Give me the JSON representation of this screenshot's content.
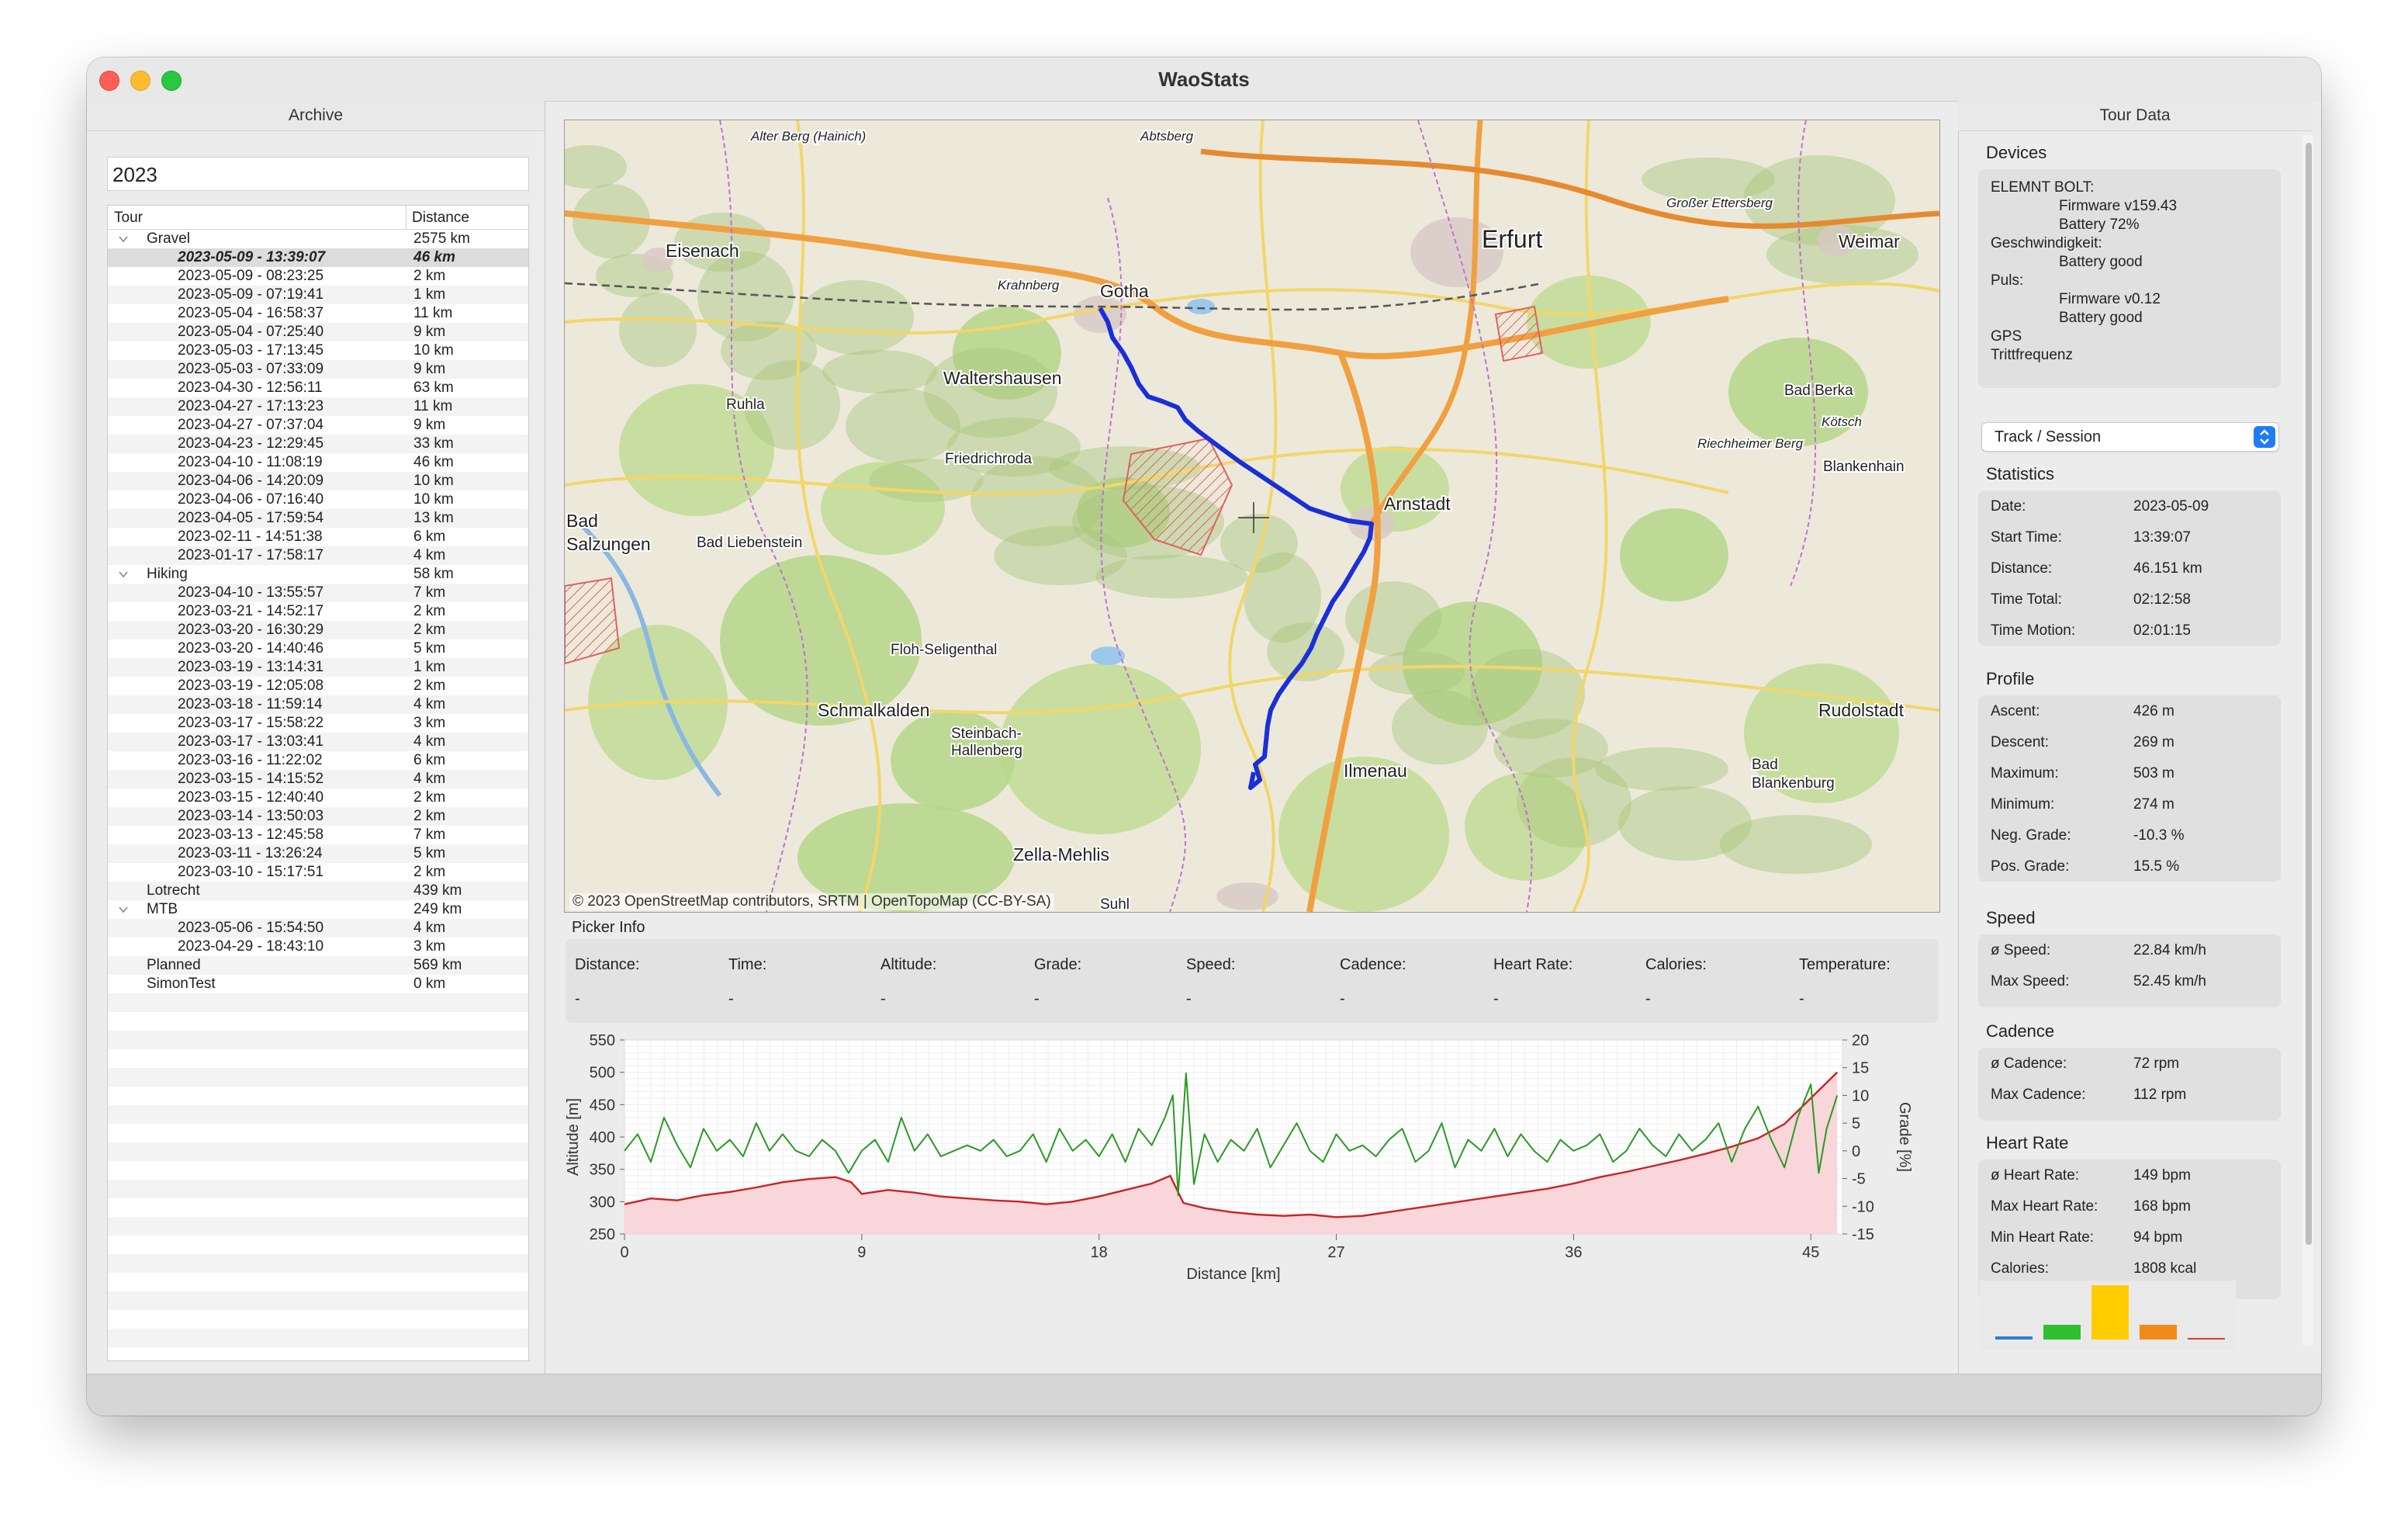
{
  "window": {
    "title": "WaoStats"
  },
  "archive": {
    "header": "Archive",
    "search_value": "2023",
    "col_tour": "Tour",
    "col_distance": "Distance",
    "rows": [
      {
        "label": "Gravel",
        "dist": "2575 km",
        "level": 0,
        "disclosure": "open"
      },
      {
        "label": "2023-05-09 - 13:39:07",
        "dist": "46 km",
        "level": 1,
        "selected": true
      },
      {
        "label": "2023-05-09 - 08:23:25",
        "dist": "2 km",
        "level": 1
      },
      {
        "label": "2023-05-09 - 07:19:41",
        "dist": "1 km",
        "level": 1
      },
      {
        "label": "2023-05-04 - 16:58:37",
        "dist": "11 km",
        "level": 1
      },
      {
        "label": "2023-05-04 - 07:25:40",
        "dist": "9 km",
        "level": 1
      },
      {
        "label": "2023-05-03 - 17:13:45",
        "dist": "10 km",
        "level": 1
      },
      {
        "label": "2023-05-03 - 07:33:09",
        "dist": "9 km",
        "level": 1
      },
      {
        "label": "2023-04-30 - 12:56:11",
        "dist": "63 km",
        "level": 1
      },
      {
        "label": "2023-04-27 - 17:13:23",
        "dist": "11 km",
        "level": 1
      },
      {
        "label": "2023-04-27 - 07:37:04",
        "dist": "9 km",
        "level": 1
      },
      {
        "label": "2023-04-23 - 12:29:45",
        "dist": "33 km",
        "level": 1
      },
      {
        "label": "2023-04-10 - 11:08:19",
        "dist": "46 km",
        "level": 1
      },
      {
        "label": "2023-04-06 - 14:20:09",
        "dist": "10 km",
        "level": 1
      },
      {
        "label": "2023-04-06 - 07:16:40",
        "dist": "10 km",
        "level": 1
      },
      {
        "label": "2023-04-05 - 17:59:54",
        "dist": "13 km",
        "level": 1
      },
      {
        "label": "2023-02-11 - 14:51:38",
        "dist": "6 km",
        "level": 1
      },
      {
        "label": "2023-01-17 - 17:58:17",
        "dist": "4 km",
        "level": 1
      },
      {
        "label": "Hiking",
        "dist": "58 km",
        "level": 0,
        "disclosure": "open"
      },
      {
        "label": "2023-04-10 - 13:55:57",
        "dist": "7 km",
        "level": 1
      },
      {
        "label": "2023-03-21 - 14:52:17",
        "dist": "2 km",
        "level": 1
      },
      {
        "label": "2023-03-20 - 16:30:29",
        "dist": "2 km",
        "level": 1
      },
      {
        "label": "2023-03-20 - 14:40:46",
        "dist": "5 km",
        "level": 1
      },
      {
        "label": "2023-03-19 - 13:14:31",
        "dist": "1 km",
        "level": 1
      },
      {
        "label": "2023-03-19 - 12:05:08",
        "dist": "2 km",
        "level": 1
      },
      {
        "label": "2023-03-18 - 11:59:14",
        "dist": "4 km",
        "level": 1
      },
      {
        "label": "2023-03-17 - 15:58:22",
        "dist": "3 km",
        "level": 1
      },
      {
        "label": "2023-03-17 - 13:03:41",
        "dist": "4 km",
        "level": 1
      },
      {
        "label": "2023-03-16 - 11:22:02",
        "dist": "6 km",
        "level": 1
      },
      {
        "label": "2023-03-15 - 14:15:52",
        "dist": "4 km",
        "level": 1
      },
      {
        "label": "2023-03-15 - 12:40:40",
        "dist": "2 km",
        "level": 1
      },
      {
        "label": "2023-03-14 - 13:50:03",
        "dist": "2 km",
        "level": 1
      },
      {
        "label": "2023-03-13 - 12:45:58",
        "dist": "7 km",
        "level": 1
      },
      {
        "label": "2023-03-11 - 13:26:24",
        "dist": "5 km",
        "level": 1
      },
      {
        "label": "2023-03-10 - 15:17:51",
        "dist": "2 km",
        "level": 1
      },
      {
        "label": "Lotrecht",
        "dist": "439 km",
        "level": 0
      },
      {
        "label": "MTB",
        "dist": "249 km",
        "level": 0,
        "disclosure": "open"
      },
      {
        "label": "2023-05-06 - 15:54:50",
        "dist": "4 km",
        "level": 1
      },
      {
        "label": "2023-04-29 - 18:43:10",
        "dist": "3 km",
        "level": 1
      },
      {
        "label": "Planned",
        "dist": "569 km",
        "level": 0
      },
      {
        "label": "SimonTest",
        "dist": "0 km",
        "level": 0
      }
    ]
  },
  "map": {
    "copyright": "© 2023 OpenStreetMap contributors, SRTM | OpenTopoMap (CC-BY-SA)",
    "places": [
      {
        "name": "Alter Berg (Hainich)",
        "size": "s"
      },
      {
        "name": "Abtsberg",
        "size": "s"
      },
      {
        "name": "Erfurt",
        "size": "xl"
      },
      {
        "name": "Großer Ettersberg",
        "size": "s"
      },
      {
        "name": "Weimar",
        "size": "l"
      },
      {
        "name": "Eisenach",
        "size": "l"
      },
      {
        "name": "Krahnberg",
        "size": "s"
      },
      {
        "name": "Gotha",
        "size": "l"
      },
      {
        "name": "Waltershausen",
        "size": "l"
      },
      {
        "name": "Bad Berka",
        "size": "m"
      },
      {
        "name": "Kötsch",
        "size": "s"
      },
      {
        "name": "Ruhla",
        "size": "m"
      },
      {
        "name": "Friedrichroda",
        "size": "m"
      },
      {
        "name": "Riechheimer Berg",
        "size": "s"
      },
      {
        "name": "Blankenhain",
        "size": "m"
      },
      {
        "name": "Arnstadt",
        "size": "l"
      },
      {
        "name": "Bad",
        "size": "l"
      },
      {
        "name": "Salzungen",
        "size": "l"
      },
      {
        "name": "Bad Liebenstein",
        "size": "m"
      },
      {
        "name": "Floh-Seligenthal",
        "size": "m"
      },
      {
        "name": "Schmalkalden",
        "size": "l"
      },
      {
        "name": "Steinbach-",
        "size": "m"
      },
      {
        "name": "Hallenberg",
        "size": "m"
      },
      {
        "name": "Rudolstadt",
        "size": "l"
      },
      {
        "name": "Ilmenau",
        "size": "l"
      },
      {
        "name": "Bad",
        "size": "m"
      },
      {
        "name": "Blankenburg",
        "size": "m"
      },
      {
        "name": "Zella-Mehlis",
        "size": "l"
      },
      {
        "name": "Suhl",
        "size": "m"
      }
    ]
  },
  "picker": {
    "title": "Picker Info",
    "fields": [
      {
        "label": "Distance:",
        "value": "-"
      },
      {
        "label": "Time:",
        "value": "-"
      },
      {
        "label": "Altitude:",
        "value": "-"
      },
      {
        "label": "Grade:",
        "value": "-"
      },
      {
        "label": "Speed:",
        "value": "-"
      },
      {
        "label": "Cadence:",
        "value": "-"
      },
      {
        "label": "Heart Rate:",
        "value": "-"
      },
      {
        "label": "Calories:",
        "value": "-"
      },
      {
        "label": "Temperature:",
        "value": "-"
      }
    ]
  },
  "chart_data": {
    "type": "line",
    "xlabel": "Distance [km]",
    "ylabel": "Altitude [m]",
    "y2label": "Grade [%]",
    "xlim": [
      0,
      46.2
    ],
    "ylim": [
      250,
      550
    ],
    "y2lim": [
      -15,
      20
    ],
    "xticks": [
      0,
      9,
      18,
      27,
      36,
      45
    ],
    "yticks": [
      250,
      300,
      350,
      400,
      450,
      500,
      550
    ],
    "y2ticks": [
      -15,
      -10,
      -5,
      0,
      5,
      10,
      15,
      20
    ],
    "grid": true,
    "series": [
      {
        "name": "altitude",
        "color": "#cc2222",
        "fill": "#f8d6da",
        "x": [
          0,
          1,
          2,
          3,
          4,
          5,
          6,
          7,
          8,
          8.6,
          9,
          10,
          11,
          12,
          13,
          14,
          15,
          16,
          17,
          18,
          19,
          20,
          20.7,
          21.2,
          22,
          23,
          24,
          25,
          26,
          27,
          28,
          29,
          30,
          31,
          32,
          33,
          34,
          35,
          36,
          37,
          38,
          39,
          40,
          41,
          42,
          43,
          44,
          45,
          46
        ],
        "y": [
          296,
          305,
          302,
          310,
          315,
          322,
          330,
          335,
          338,
          330,
          312,
          318,
          314,
          308,
          305,
          302,
          300,
          296,
          300,
          308,
          318,
          328,
          340,
          298,
          290,
          284,
          280,
          278,
          280,
          276,
          278,
          284,
          290,
          296,
          302,
          308,
          314,
          320,
          328,
          338,
          346,
          355,
          364,
          374,
          385,
          398,
          420,
          460,
          500
        ]
      },
      {
        "name": "grade",
        "color": "#2a9a24",
        "x": [
          0,
          0.5,
          1,
          1.5,
          2,
          2.5,
          3,
          3.5,
          4,
          4.5,
          5,
          5.5,
          6,
          6.5,
          7,
          7.5,
          8,
          8.5,
          9,
          9.5,
          10,
          10.5,
          11,
          11.5,
          12,
          12.5,
          13,
          13.5,
          14,
          14.5,
          15,
          15.5,
          16,
          16.5,
          17,
          17.5,
          18,
          18.5,
          19,
          19.5,
          20,
          20.5,
          20.8,
          21,
          21.3,
          21.6,
          22,
          22.5,
          23,
          23.5,
          24,
          24.5,
          25,
          25.5,
          26,
          26.5,
          27,
          27.5,
          28,
          28.5,
          29,
          29.5,
          30,
          30.5,
          31,
          31.5,
          32,
          32.5,
          33,
          33.5,
          34,
          34.5,
          35,
          35.5,
          36,
          36.5,
          37,
          37.5,
          38,
          38.5,
          39,
          39.5,
          40,
          40.5,
          41,
          41.5,
          42,
          42.5,
          43,
          43.5,
          44,
          44.5,
          45,
          45.3,
          45.6,
          46
        ],
        "y": [
          0,
          3,
          -2,
          6,
          1,
          -3,
          4,
          0,
          2,
          -1,
          5,
          0,
          3,
          0,
          -1,
          2,
          0,
          -4,
          0,
          2,
          -2,
          6,
          0,
          3,
          -1,
          0,
          1,
          0,
          2,
          -1,
          0,
          3,
          -2,
          4,
          0,
          2,
          -1,
          3,
          -2,
          4,
          1,
          6,
          10,
          -8,
          14,
          -6,
          3,
          -2,
          2,
          0,
          4,
          -3,
          1,
          5,
          0,
          -2,
          3,
          0,
          1,
          -1,
          2,
          4,
          -2,
          0,
          5,
          -3,
          2,
          0,
          4,
          -1,
          3,
          0,
          -2,
          2,
          0,
          1,
          3,
          -2,
          0,
          4,
          1,
          -1,
          3,
          0,
          2,
          5,
          -2,
          4,
          8,
          2,
          -3,
          6,
          12,
          -4,
          4,
          10
        ]
      }
    ]
  },
  "tour": {
    "header": "Tour Data",
    "devices_title": "Devices",
    "devices": [
      {
        "text": "ELEMNT BOLT:",
        "indent": 0
      },
      {
        "text": "Firmware v159.43",
        "indent": 1
      },
      {
        "text": "Battery 72%",
        "indent": 1
      },
      {
        "text": "Geschwindigkeit:",
        "indent": 0
      },
      {
        "text": "Battery good",
        "indent": 1
      },
      {
        "text": "Puls:",
        "indent": 0
      },
      {
        "text": "Firmware v0.12",
        "indent": 1
      },
      {
        "text": "Battery good",
        "indent": 1
      },
      {
        "text": "GPS",
        "indent": 0
      },
      {
        "text": "Trittfrequenz",
        "indent": 0
      }
    ],
    "mode_select": "Track / Session",
    "sections": [
      {
        "title": "Statistics",
        "rows": [
          [
            "Date:",
            "2023-05-09"
          ],
          [
            "Start Time:",
            "13:39:07"
          ],
          [
            "Distance:",
            "46.151 km"
          ],
          [
            "Time Total:",
            "02:12:58"
          ],
          [
            "Time Motion:",
            "02:01:15"
          ]
        ]
      },
      {
        "title": "Profile",
        "rows": [
          [
            "Ascent:",
            "426 m"
          ],
          [
            "Descent:",
            "269 m"
          ],
          [
            "Maximum:",
            "503 m"
          ],
          [
            "Minimum:",
            "274 m"
          ],
          [
            "Neg. Grade:",
            "-10.3 %"
          ],
          [
            "Pos. Grade:",
            "15.5 %"
          ]
        ]
      },
      {
        "title": "Speed",
        "rows": [
          [
            "ø Speed:",
            "22.84 km/h"
          ],
          [
            "Max Speed:",
            "52.45 km/h"
          ]
        ]
      },
      {
        "title": "Cadence",
        "rows": [
          [
            "ø Cadence:",
            "72 rpm"
          ],
          [
            "Max Cadence:",
            "112 rpm"
          ]
        ]
      },
      {
        "title": "Heart Rate",
        "rows": [
          [
            "ø Heart Rate:",
            "149 bpm"
          ],
          [
            "Max Heart Rate:",
            "168 bpm"
          ],
          [
            "Min Heart Rate:",
            "94 bpm"
          ],
          [
            "Calories:",
            "1808 kcal"
          ]
        ]
      }
    ],
    "hr_zones": [
      {
        "fraction": 0.05,
        "color": "#2a7fd4"
      },
      {
        "fraction": 0.27,
        "color": "#2fbf2f"
      },
      {
        "fraction": 1.0,
        "color": "#ffcc00"
      },
      {
        "fraction": 0.27,
        "color": "#f28a1a"
      },
      {
        "fraction": 0.02,
        "color": "#e23c2c"
      }
    ]
  }
}
